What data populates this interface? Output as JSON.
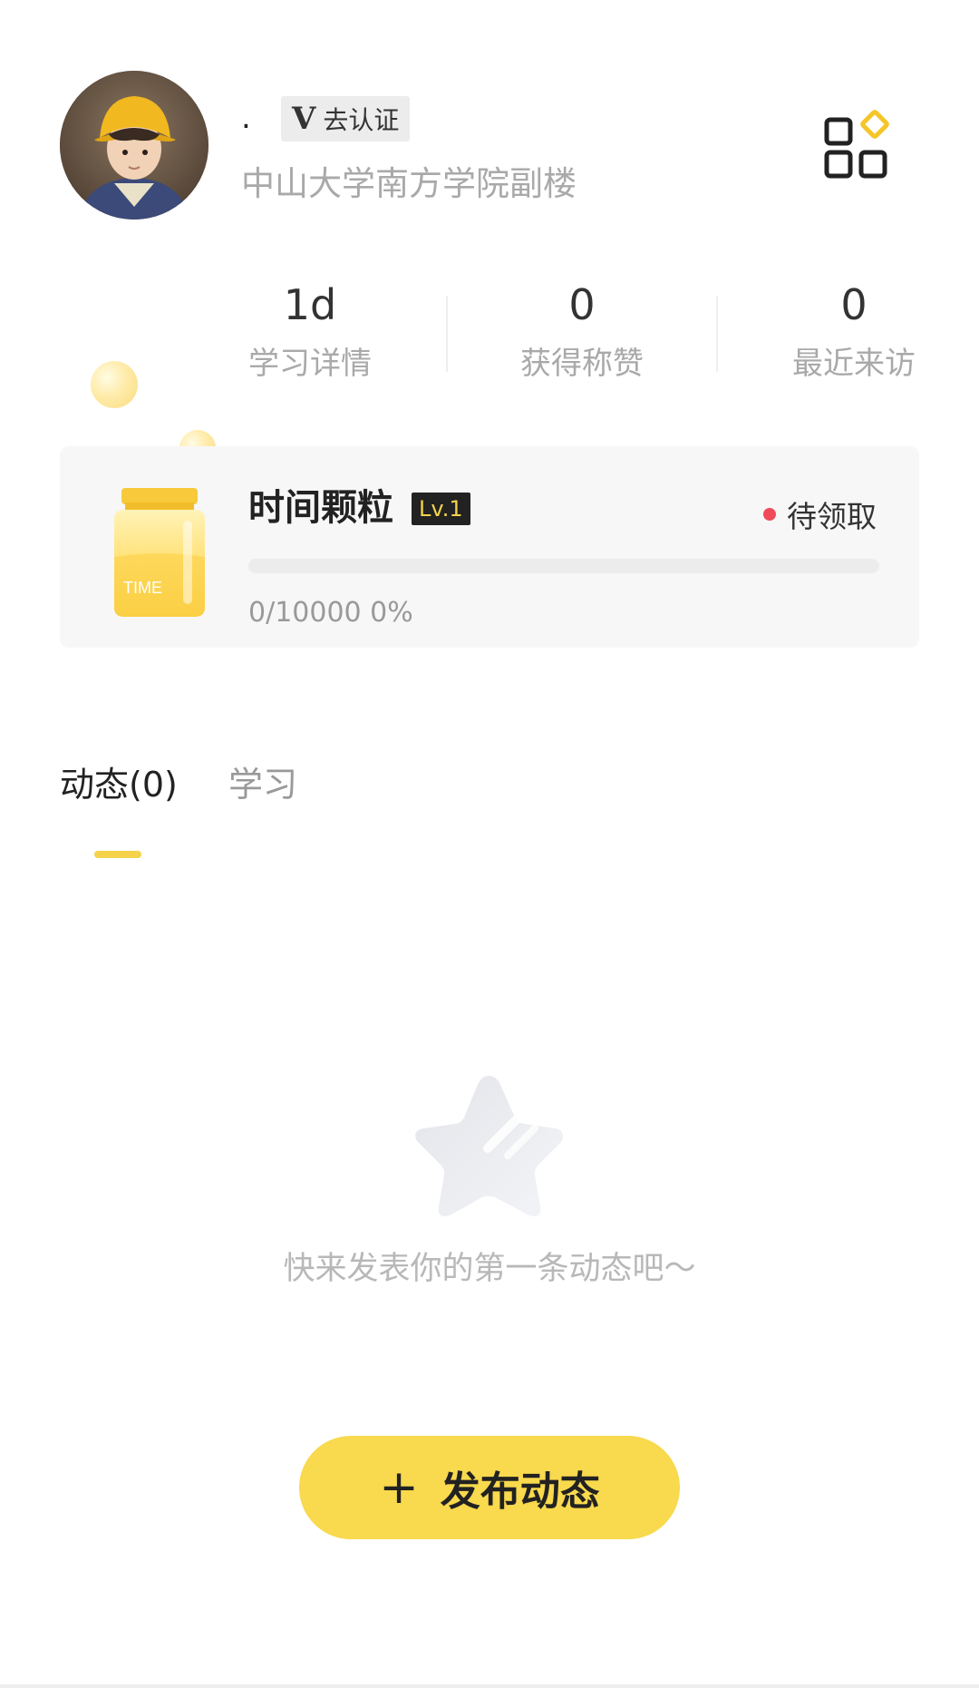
{
  "profile": {
    "nickname": ".",
    "verify_label": "去认证",
    "verify_mark": "V",
    "school": "中山大学南方学院副楼"
  },
  "stats": [
    {
      "value": "1d",
      "label": "学习详情"
    },
    {
      "value": "0",
      "label": "获得称赞"
    },
    {
      "value": "0",
      "label": "最近来访"
    }
  ],
  "time_card": {
    "title": "时间颗粒",
    "level": "Lv.1",
    "status": "待领取",
    "progress_text": "0/10000 0%",
    "progress_fraction": 0,
    "jar_label": "TIME"
  },
  "tabs": [
    {
      "label": "动态(0)",
      "active": true
    },
    {
      "label": "学习",
      "active": false
    }
  ],
  "empty_state": {
    "message": "快来发表你的第一条动态吧～"
  },
  "publish_button": {
    "plus": "+",
    "label": "发布动态"
  },
  "colors": {
    "accent": "#f9d94d",
    "status_dot": "#f04a5a",
    "muted_text": "#a9a9a9"
  },
  "icons": [
    "apps-grid-icon",
    "verify-v-icon",
    "time-jar-icon",
    "empty-star-icon",
    "plus-icon"
  ]
}
